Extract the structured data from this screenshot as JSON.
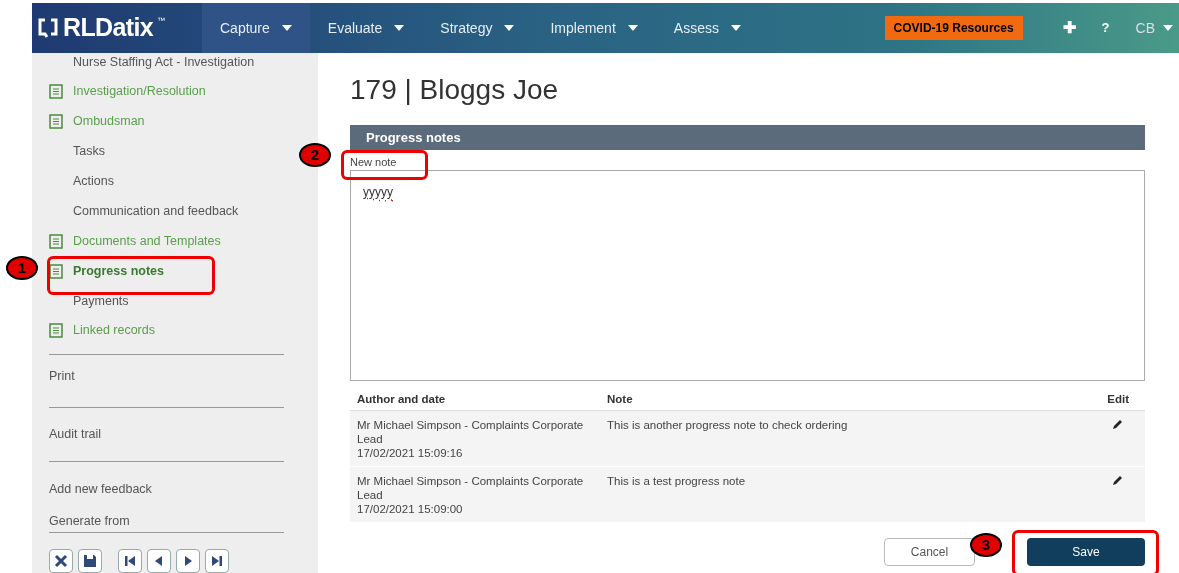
{
  "header": {
    "logo": "RLDatix",
    "logo_mark": "™",
    "menus": [
      {
        "label": "Capture",
        "selected": true
      },
      {
        "label": "Evaluate",
        "selected": false
      },
      {
        "label": "Strategy",
        "selected": false
      },
      {
        "label": "Implement",
        "selected": false
      },
      {
        "label": "Assess",
        "selected": false
      }
    ],
    "covid_button": "COVID-19 Resources",
    "plus": "✚",
    "help": "?",
    "user": "CB"
  },
  "sidebar": {
    "items": [
      {
        "label": "Nurse Staffing Act - Investigation",
        "kind": "plain",
        "selected": false
      },
      {
        "label": "Investigation/Resolution",
        "kind": "form",
        "selected": false
      },
      {
        "label": "Ombudsman",
        "kind": "form",
        "selected": false
      },
      {
        "label": "Tasks",
        "kind": "plain",
        "selected": false
      },
      {
        "label": "Actions",
        "kind": "plain",
        "selected": false
      },
      {
        "label": "Communication and feedback",
        "kind": "plain",
        "selected": false
      },
      {
        "label": "Documents and Templates",
        "kind": "form",
        "selected": false
      },
      {
        "label": "Progress notes",
        "kind": "form",
        "selected": true
      },
      {
        "label": "Payments",
        "kind": "plain",
        "selected": false
      },
      {
        "label": "Linked records",
        "kind": "form",
        "selected": false
      }
    ],
    "links": [
      "Print",
      "Audit trail",
      "Add new feedback",
      "Generate from"
    ]
  },
  "main": {
    "title": "179 | Bloggs Joe",
    "panel_title": "Progress notes",
    "note_label": "New note",
    "note_value": "yyyyy",
    "table": {
      "columns": [
        "Author and date",
        "Note",
        "Edit"
      ],
      "rows": [
        {
          "author": "Mr Michael Simpson - Complaints Corporate Lead",
          "date": "17/02/2021 15:09:16",
          "note": "This is another progress note to check ordering"
        },
        {
          "author": "Mr Michael Simpson - Complaints Corporate Lead",
          "date": "17/02/2021 15:09:00",
          "note": "This is a test progress note"
        }
      ]
    },
    "buttons": {
      "cancel": "Cancel",
      "save": "Save"
    }
  },
  "callouts": [
    "1",
    "2",
    "3"
  ]
}
